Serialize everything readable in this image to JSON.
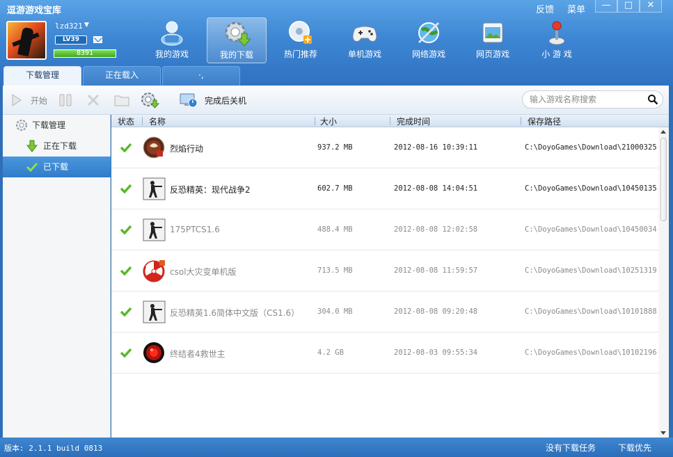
{
  "app": {
    "title": "逗游游戏宝库"
  },
  "top_links": {
    "feedback": "反馈",
    "menu": "菜单"
  },
  "window_controls": {
    "minimize": "—",
    "maximize": "□",
    "close": "✕"
  },
  "user": {
    "name": "lzd321",
    "level": "LV39",
    "exp": "8391",
    "mail_icon": "mail-icon"
  },
  "nav": [
    {
      "label": "我的游戏",
      "icon": "my-games-icon"
    },
    {
      "label": "我的下载",
      "icon": "my-downloads-icon"
    },
    {
      "label": "热门推荐",
      "icon": "hot-recommend-icon"
    },
    {
      "label": "单机游戏",
      "icon": "gamepad-icon"
    },
    {
      "label": "网络游戏",
      "icon": "online-games-icon"
    },
    {
      "label": "网页游戏",
      "icon": "web-games-icon"
    },
    {
      "label": "小 游 戏",
      "icon": "joystick-icon"
    }
  ],
  "tabs": [
    {
      "label": "下载管理"
    },
    {
      "label": "正在载入"
    },
    {
      "label": "·,"
    }
  ],
  "toolbar": {
    "start": "开始",
    "shutdown_after": "完成后关机"
  },
  "search": {
    "placeholder": "输入游戏名称搜索"
  },
  "sidebar": {
    "header": "下载管理",
    "items": [
      {
        "label": "正在下载"
      },
      {
        "label": "已下载"
      }
    ]
  },
  "table": {
    "headers": {
      "status": "状态",
      "name": "名称",
      "size": "大小",
      "time": "完成时间",
      "path": "保存路径"
    },
    "rows": [
      {
        "name": "烈焰行动",
        "size": "937.2 MB",
        "time": "2012-08-16 10:39:11",
        "path": "C:\\DoyoGames\\Download\\21000325",
        "icon": "fire-operation-icon"
      },
      {
        "name": "反恐精英：现代战争2",
        "size": "602.7 MB",
        "time": "2012-08-08 14:04:51",
        "path": "C:\\DoyoGames\\Download\\10450135",
        "icon": "counter-strike-icon"
      },
      {
        "name": "175PTCS1.6",
        "size": "488.4 MB",
        "time": "2012-08-08 12:02:58",
        "path": "C:\\DoyoGames\\Download\\10450034",
        "icon": "counter-strike-icon"
      },
      {
        "name": "csol大灾变单机版",
        "size": "713.5 MB",
        "time": "2012-08-08 11:59:57",
        "path": "C:\\DoyoGames\\Download\\10251319",
        "icon": "umbrella-icon"
      },
      {
        "name": "反恐精英1.6简体中文版（CS1.6）",
        "size": "304.0 MB",
        "time": "2012-08-08 09:20:48",
        "path": "C:\\DoyoGames\\Download\\10101888",
        "icon": "counter-strike-icon"
      },
      {
        "name": "终结者4救世主",
        "size": "4.2 GB",
        "time": "2012-08-03 09:55:34",
        "path": "C:\\DoyoGames\\Download\\10102196",
        "icon": "terminator-eye-icon"
      }
    ]
  },
  "status_bar": {
    "version": "版本: 2.1.1 build 0813",
    "no_task": "没有下载任务",
    "priority": "下载优先"
  },
  "colors": {
    "accent": "#2f7cc9",
    "check": "#5cb82a"
  }
}
